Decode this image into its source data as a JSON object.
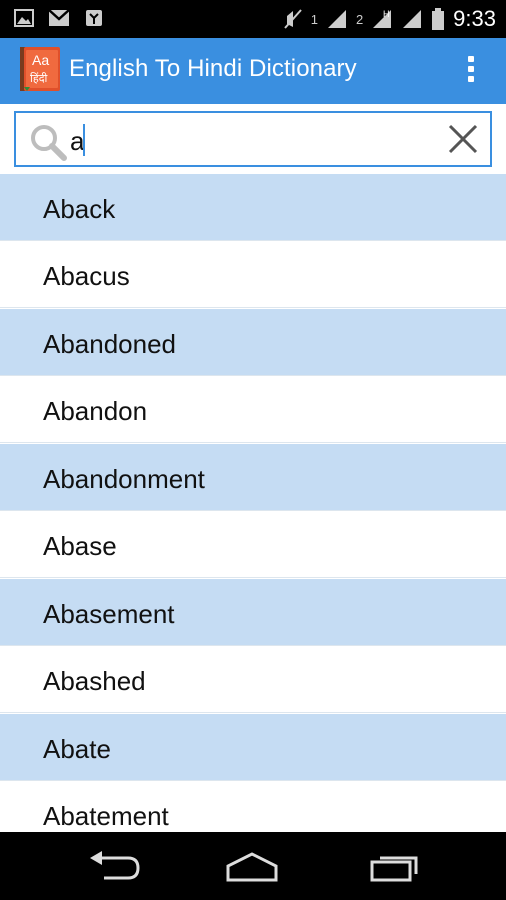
{
  "status_bar": {
    "time": "9:33",
    "sim1": "1",
    "sim2": "2",
    "network_tag": "H",
    "icons": [
      "image-icon",
      "gmail-icon",
      "usb-debug-icon",
      "mute-icon",
      "signal-icon",
      "wifi-icon",
      "battery-icon"
    ]
  },
  "app_bar": {
    "title": "English To Hindi Dictionary",
    "icon_text_top": "Aa",
    "icon_text_bottom": "हिंदी",
    "accent_color": "#3a8fe0"
  },
  "search": {
    "value": "a",
    "placeholder": ""
  },
  "words": [
    "Aback",
    "Abacus",
    "Abandoned",
    "Abandon",
    "Abandonment",
    "Abase",
    "Abasement",
    "Abashed",
    "Abate",
    "Abatement"
  ],
  "colors": {
    "row_alt": "#c5dcf3",
    "row_plain": "#ffffff"
  }
}
